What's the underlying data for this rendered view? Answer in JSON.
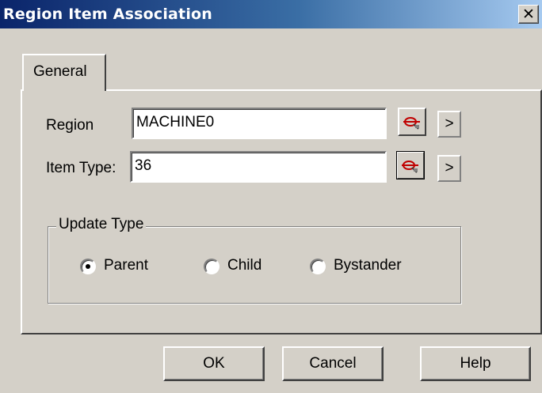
{
  "window": {
    "title": "Region Item Association",
    "close_glyph": "✕"
  },
  "tabs": [
    {
      "label": "General",
      "selected": true
    }
  ],
  "form": {
    "region": {
      "label": "Region",
      "value": "MACHINE0",
      "lookup_icon": "lookup-icon",
      "arrow_label": ">"
    },
    "item_type": {
      "label": "Item Type:",
      "value": "36",
      "lookup_icon": "lookup-icon",
      "arrow_label": ">"
    }
  },
  "update_type": {
    "title": "Update Type",
    "options": [
      {
        "label": "Parent",
        "checked": true
      },
      {
        "label": "Child",
        "checked": false
      },
      {
        "label": "Bystander",
        "checked": false
      }
    ]
  },
  "buttons": {
    "ok": "OK",
    "cancel": "Cancel",
    "help": "Help"
  },
  "colors": {
    "title_gradient_start": "#0a246a",
    "title_gradient_end": "#a6caf0",
    "face": "#d4d0c8",
    "lookup_icon_red": "#c00000"
  }
}
